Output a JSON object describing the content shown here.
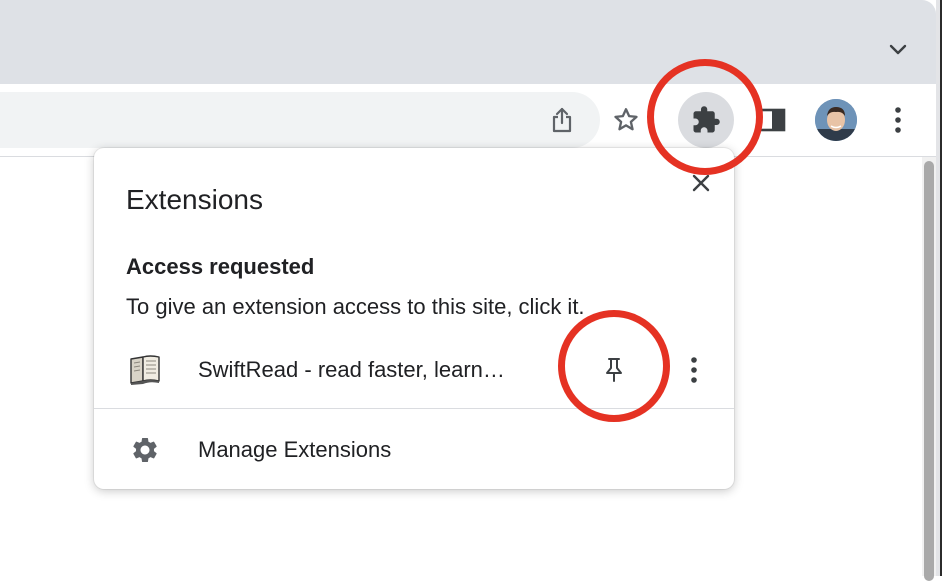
{
  "browser": {
    "tab_search_icon": "chevron-down-icon",
    "toolbar": {
      "buttons": [
        "share-icon",
        "star-icon",
        "puzzle-icon",
        "side-panel-icon",
        "avatar",
        "kebab-menu-icon"
      ]
    }
  },
  "extensions_popup": {
    "title": "Extensions",
    "section_heading": "Access requested",
    "section_description": "To give an extension access to this site, click it.",
    "extension": {
      "name": "SwiftRead - read faster, learn…",
      "icon": "book-icon",
      "pin_icon": "pin-icon",
      "more_icon": "kebab-menu-icon"
    },
    "manage_label": "Manage Extensions",
    "manage_icon": "gear-icon",
    "close_icon": "close-icon"
  },
  "colors": {
    "highlight_ring": "#e53223",
    "tabstrip": "#dee1e6",
    "text": "#202124"
  }
}
